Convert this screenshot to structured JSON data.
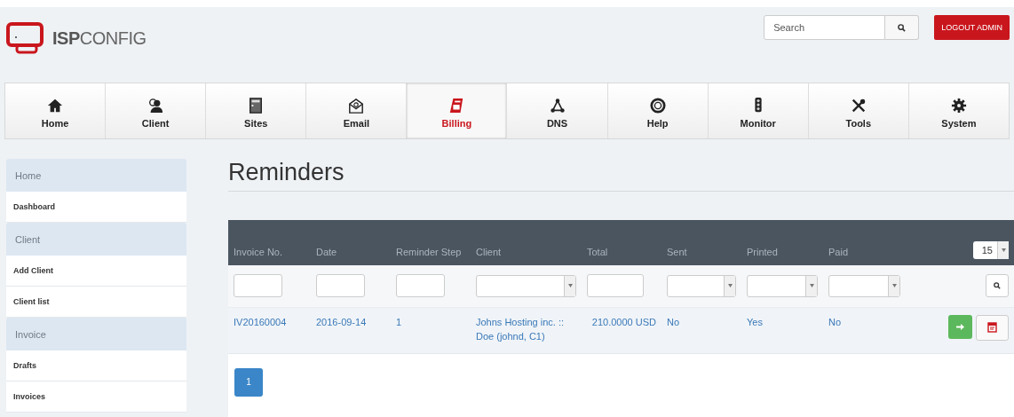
{
  "logo": {
    "bold": "ISP",
    "light": "CONFIG"
  },
  "search": {
    "placeholder": "Search"
  },
  "logout": "LOGOUT ADMIN",
  "nav": [
    {
      "label": "Home",
      "selected": false
    },
    {
      "label": "Client",
      "selected": false
    },
    {
      "label": "Sites",
      "selected": false
    },
    {
      "label": "Email",
      "selected": false
    },
    {
      "label": "Billing",
      "selected": true
    },
    {
      "label": "DNS",
      "selected": false
    },
    {
      "label": "Help",
      "selected": false
    },
    {
      "label": "Monitor",
      "selected": false
    },
    {
      "label": "Tools",
      "selected": false
    },
    {
      "label": "System",
      "selected": false
    }
  ],
  "sidebar": [
    {
      "kind": "header",
      "label": "Home"
    },
    {
      "kind": "link",
      "label": "Dashboard"
    },
    {
      "kind": "header",
      "label": "Client"
    },
    {
      "kind": "link",
      "label": "Add Client"
    },
    {
      "kind": "link",
      "label": "Client list"
    },
    {
      "kind": "header",
      "label": "Invoice"
    },
    {
      "kind": "link",
      "label": "Drafts"
    },
    {
      "kind": "link",
      "label": "Invoices"
    }
  ],
  "title": "Reminders",
  "table": {
    "columns": [
      {
        "label": "Invoice No.",
        "kind": "text"
      },
      {
        "label": "Date",
        "kind": "text"
      },
      {
        "label": "Reminder Step",
        "kind": "text"
      },
      {
        "label": "Client",
        "kind": "select"
      },
      {
        "label": "Total",
        "kind": "text"
      },
      {
        "label": "Sent",
        "kind": "select"
      },
      {
        "label": "Printed",
        "kind": "select"
      },
      {
        "label": "Paid",
        "kind": "select"
      }
    ],
    "page_size": "15",
    "rows": [
      {
        "cells": [
          "IV20160004",
          "2016-09-14",
          "1",
          "Johns Hosting inc. :: Doe (johnd, C1)",
          "210.0000 USD",
          "No",
          "Yes",
          "No"
        ]
      }
    ]
  },
  "pagination": [
    {
      "label": "1",
      "selected": true
    }
  ]
}
